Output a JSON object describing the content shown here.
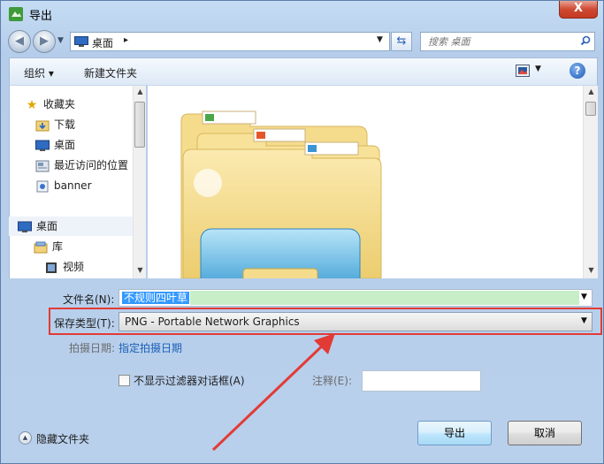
{
  "window": {
    "title": "导出",
    "close_label": "X"
  },
  "address": {
    "back_icon": "back-arrow-icon",
    "forward_icon": "forward-arrow-icon",
    "location": "桌面",
    "separator": "▸",
    "search_placeholder": "搜索 桌面"
  },
  "toolbar": {
    "organize": "组织 ▾",
    "new_folder": "新建文件夹",
    "help": "?"
  },
  "sidebar": {
    "favorites_header": "收藏夹",
    "favorites": [
      "下载",
      "桌面",
      "最近访问的位置",
      "banner"
    ],
    "desktop_header": "桌面",
    "library_items": [
      "库",
      "视频"
    ]
  },
  "form": {
    "filename_label": "文件名(N):",
    "filename_value": "不规则四叶草",
    "filetype_label": "保存类型(T):",
    "filetype_value": "PNG - Portable Network Graphics",
    "date_label": "拍摄日期:",
    "date_link": "指定拍摄日期",
    "checkbox_label": "不显示过滤器对话框(A)",
    "note_label": "注释(E):"
  },
  "footer": {
    "hide_folders": "隐藏文件夹",
    "export_button": "导出",
    "cancel_button": "取消"
  },
  "colors": {
    "highlight_box": "#e23b35",
    "arrow": "#e23b35",
    "link": "#1a5fb4"
  }
}
